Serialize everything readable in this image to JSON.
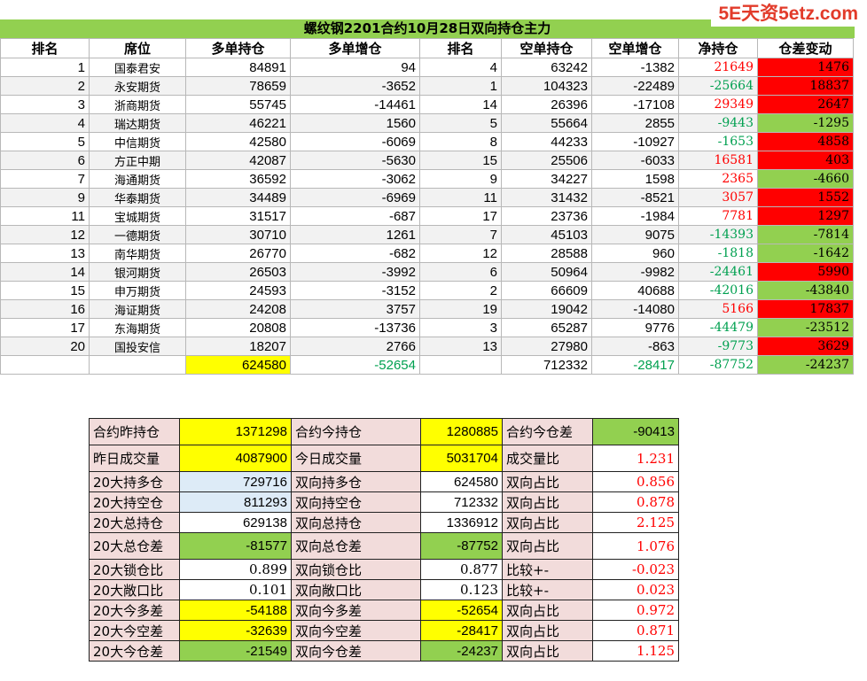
{
  "watermark": "5E天资5etz.com",
  "title": "螺纹钢2201合约10月28日双向持仓主力",
  "headers": [
    "排名",
    "席位",
    "多单持仓",
    "多单增仓",
    "排名",
    "空单持仓",
    "空单增仓",
    "净持仓",
    "仓差变动"
  ],
  "rows": [
    {
      "rank": "1",
      "seat": "国泰君安",
      "long": "84891",
      "long_chg": "94",
      "srank": "4",
      "short": "63242",
      "short_chg": "-1382",
      "net": "21649",
      "diff": "1476"
    },
    {
      "rank": "2",
      "seat": "永安期货",
      "long": "78659",
      "long_chg": "-3652",
      "srank": "1",
      "short": "104323",
      "short_chg": "-22489",
      "net": "-25664",
      "diff": "18837"
    },
    {
      "rank": "3",
      "seat": "浙商期货",
      "long": "55745",
      "long_chg": "-14461",
      "srank": "14",
      "short": "26396",
      "short_chg": "-17108",
      "net": "29349",
      "diff": "2647"
    },
    {
      "rank": "4",
      "seat": "瑞达期货",
      "long": "46221",
      "long_chg": "1560",
      "srank": "5",
      "short": "55664",
      "short_chg": "2855",
      "net": "-9443",
      "diff": "-1295"
    },
    {
      "rank": "5",
      "seat": "中信期货",
      "long": "42580",
      "long_chg": "-6069",
      "srank": "8",
      "short": "44233",
      "short_chg": "-10927",
      "net": "-1653",
      "diff": "4858"
    },
    {
      "rank": "6",
      "seat": "方正中期",
      "long": "42087",
      "long_chg": "-5630",
      "srank": "15",
      "short": "25506",
      "short_chg": "-6033",
      "net": "16581",
      "diff": "403"
    },
    {
      "rank": "7",
      "seat": "海通期货",
      "long": "36592",
      "long_chg": "-3062",
      "srank": "9",
      "short": "34227",
      "short_chg": "1598",
      "net": "2365",
      "diff": "-4660"
    },
    {
      "rank": "9",
      "seat": "华泰期货",
      "long": "34489",
      "long_chg": "-6969",
      "srank": "11",
      "short": "31432",
      "short_chg": "-8521",
      "net": "3057",
      "diff": "1552"
    },
    {
      "rank": "11",
      "seat": "宝城期货",
      "long": "31517",
      "long_chg": "-687",
      "srank": "17",
      "short": "23736",
      "short_chg": "-1984",
      "net": "7781",
      "diff": "1297"
    },
    {
      "rank": "12",
      "seat": "一德期货",
      "long": "30710",
      "long_chg": "1261",
      "srank": "7",
      "short": "45103",
      "short_chg": "9075",
      "net": "-14393",
      "diff": "-7814"
    },
    {
      "rank": "13",
      "seat": "南华期货",
      "long": "26770",
      "long_chg": "-682",
      "srank": "12",
      "short": "28588",
      "short_chg": "960",
      "net": "-1818",
      "diff": "-1642"
    },
    {
      "rank": "14",
      "seat": "银河期货",
      "long": "26503",
      "long_chg": "-3992",
      "srank": "6",
      "short": "50964",
      "short_chg": "-9982",
      "net": "-24461",
      "diff": "5990"
    },
    {
      "rank": "15",
      "seat": "申万期货",
      "long": "24593",
      "long_chg": "-3152",
      "srank": "2",
      "short": "66609",
      "short_chg": "40688",
      "net": "-42016",
      "diff": "-43840"
    },
    {
      "rank": "16",
      "seat": "海证期货",
      "long": "24208",
      "long_chg": "3757",
      "srank": "19",
      "short": "19042",
      "short_chg": "-14080",
      "net": "5166",
      "diff": "17837"
    },
    {
      "rank": "17",
      "seat": "东海期货",
      "long": "20808",
      "long_chg": "-13736",
      "srank": "3",
      "short": "65287",
      "short_chg": "9776",
      "net": "-44479",
      "diff": "-23512"
    },
    {
      "rank": "20",
      "seat": "国投安信",
      "long": "18207",
      "long_chg": "2766",
      "srank": "13",
      "short": "27980",
      "short_chg": "-863",
      "net": "-9773",
      "diff": "3629"
    }
  ],
  "totals": {
    "long": "624580",
    "long_chg": "-52654",
    "short": "712332",
    "short_chg": "-28417",
    "net": "-87752",
    "diff": "-24237"
  },
  "stats": [
    [
      "合约昨持仓",
      "1371298",
      "合约今持仓",
      "1280885",
      "合约今仓差",
      "-90413"
    ],
    [
      "昨日成交量",
      "4087900",
      "今日成交量",
      "5031704",
      "成交量比",
      "1.231"
    ],
    [
      "20大持多仓",
      "729716",
      "双向持多仓",
      "624580",
      "双向占比",
      "0.856"
    ],
    [
      "20大持空仓",
      "811293",
      "双向持空仓",
      "712332",
      "双向占比",
      "0.878"
    ],
    [
      "20大总持仓",
      "629138",
      "双向总持仓",
      "1336912",
      "双向占比",
      "2.125"
    ],
    [
      "20大总仓差",
      "-81577",
      "双向总仓差",
      "-87752",
      "双向占比",
      "1.076"
    ],
    [
      "20大锁仓比",
      "0.899",
      "双向锁仓比",
      "0.877",
      "比较+-",
      "-0.023"
    ],
    [
      "20大敞口比",
      "0.101",
      "双向敞口比",
      "0.123",
      "比较+-",
      "0.023"
    ],
    [
      "20大今多差",
      "-54188",
      "双向今多差",
      "-52654",
      "双向占比",
      "0.972"
    ],
    [
      "20大今空差",
      "-32639",
      "双向今空差",
      "-28417",
      "双向占比",
      "0.871"
    ],
    [
      "20大今仓差",
      "-21549",
      "双向今仓差",
      "-24237",
      "双向占比",
      "1.125"
    ]
  ],
  "colors": {
    "header_green": "#92d050",
    "up_red": "#ff0000",
    "down_green": "#00a050",
    "highlight_yellow": "#ffff00",
    "label_pink": "#f2dcdb",
    "light_blue": "#ddebf7"
  }
}
